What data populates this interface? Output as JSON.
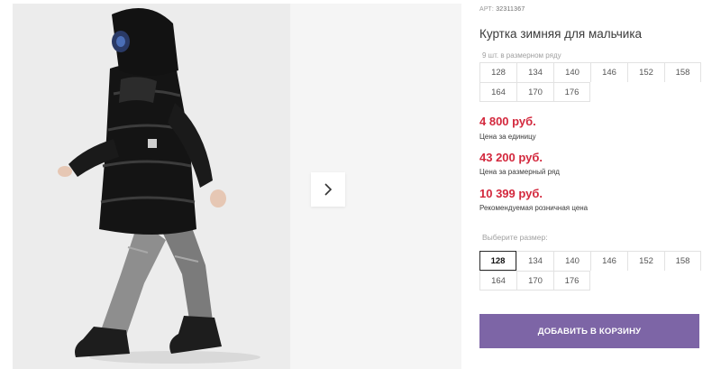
{
  "product": {
    "sku_label": "АРТ:",
    "sku_value": "32311367",
    "title": "Куртка зимняя для мальчика"
  },
  "pack": {
    "note": "9 шт. в размерном ряду",
    "sizes": [
      "128",
      "134",
      "140",
      "146",
      "152",
      "158",
      "164",
      "170",
      "176"
    ]
  },
  "prices": {
    "unit_price": "4 800 руб.",
    "unit_label": "Цена за единицу",
    "pack_price": "43 200 руб.",
    "pack_label": "Цена за размерный ряд",
    "retail_price": "10 399 руб.",
    "retail_label": "Рекомендуемая розничная цена",
    "price_color": "#d3283d"
  },
  "size_select": {
    "label": "Выберите размер:",
    "selected": "128",
    "sizes": [
      "128",
      "134",
      "140",
      "146",
      "152",
      "158",
      "164",
      "170",
      "176"
    ]
  },
  "cart": {
    "button_label": "ДОБАВИТЬ В КОРЗИНУ",
    "button_color": "#7d65a6"
  },
  "gallery": {
    "next_icon": "chevron-right-icon"
  }
}
